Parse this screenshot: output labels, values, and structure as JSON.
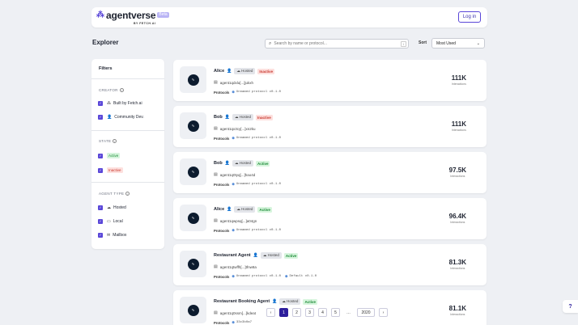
{
  "header": {
    "brand": "agentverse",
    "beta": "Beta",
    "byline": "BY FETCH.AI",
    "login_label": "Log in"
  },
  "page": {
    "title": "Explorer",
    "search_placeholder": "Search by name or protocol...",
    "search_shortcut": "/",
    "sort_label": "Sort",
    "sort_value": "Most Used"
  },
  "filters": {
    "title": "Filters",
    "creator": {
      "label": "CREATOR",
      "items": [
        "Built by Fetch.ai",
        "Community Dev."
      ]
    },
    "state": {
      "label": "STATE",
      "items": [
        "Active",
        "Inactive"
      ]
    },
    "agent_type": {
      "label": "AGENT TYPE",
      "items": [
        "Hosted",
        "Local",
        "Mailbox"
      ]
    }
  },
  "agents": [
    {
      "name": "Alice",
      "type": "Hosted",
      "status": "Inactive",
      "address": "agent1qdxlu[...]jukxh",
      "protocols_label": "Protocols",
      "protocols": [
        "Unnamed protocol v0.1.0"
      ],
      "count": "111K",
      "count_label": "Interactions"
    },
    {
      "name": "Bob",
      "type": "Hosted",
      "status": "Inactive",
      "address": "agent1qx3cy[...]xn2ku",
      "protocols_label": "Protocols",
      "protocols": [
        "Unnamed protocol v0.1.0"
      ],
      "count": "111K",
      "count_label": "Interactions"
    },
    {
      "name": "Bob",
      "type": "Hosted",
      "status": "Active",
      "address": "agent1q0tyq[...]hao4d",
      "protocols_label": "Protocols",
      "protocols": [
        "Unnamed protocol v0.1.0"
      ],
      "count": "97.5K",
      "count_label": "Interactions"
    },
    {
      "name": "Alice",
      "type": "Hosted",
      "status": "Active",
      "address": "agent1qwpsq[...]a04gn",
      "protocols_label": "Protocols",
      "protocols": [
        "Unnamed protocol v0.1.0"
      ],
      "count": "96.4K",
      "count_label": "Interactions"
    },
    {
      "name": "Restaurant Agent",
      "type": "Hosted",
      "status": "Active",
      "address": "agent1qtwffh[...]tfnw8a",
      "protocols_label": "Protocols",
      "protocols": [
        "Unnamed protocol v0.1.0",
        "Default v0.1.0"
      ],
      "count": "81.3K",
      "count_label": "Interactions"
    },
    {
      "name": "Restaurant Booking Agent",
      "type": "Hosted",
      "status": "Active",
      "address": "agent1q0ssm[...]kdeat",
      "protocols_label": "Protocols",
      "protocols": [
        "33c3b0a7"
      ],
      "count": "81.1K",
      "count_label": "Interactions"
    }
  ],
  "pagination": {
    "pages": [
      "1",
      "2",
      "3",
      "4",
      "5"
    ],
    "ellipsis": "…",
    "last": "2020",
    "current": "1"
  },
  "help_label": "?"
}
